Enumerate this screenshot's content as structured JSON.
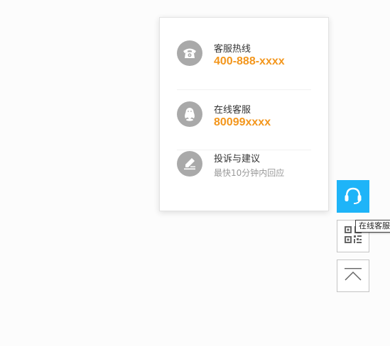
{
  "contact_panel": {
    "hotline": {
      "label": "客服热线",
      "value": "400-888-xxxx",
      "icon": "phone-icon"
    },
    "online": {
      "label": "在线客服",
      "value": "80099xxxx",
      "icon": "qq-icon"
    },
    "feedback": {
      "label": "投诉与建议",
      "sub": "最快10分钟内回应",
      "icon": "edit-icon"
    }
  },
  "sidebar": {
    "service_icon": "headset-icon",
    "qr_icon": "qrcode-icon",
    "top_icon": "back-to-top-icon",
    "tooltip": "在线客服"
  },
  "colors": {
    "accent": "#f3961c",
    "service_blue": "#1eb4f8",
    "icon_gray": "#a9a9a9"
  }
}
